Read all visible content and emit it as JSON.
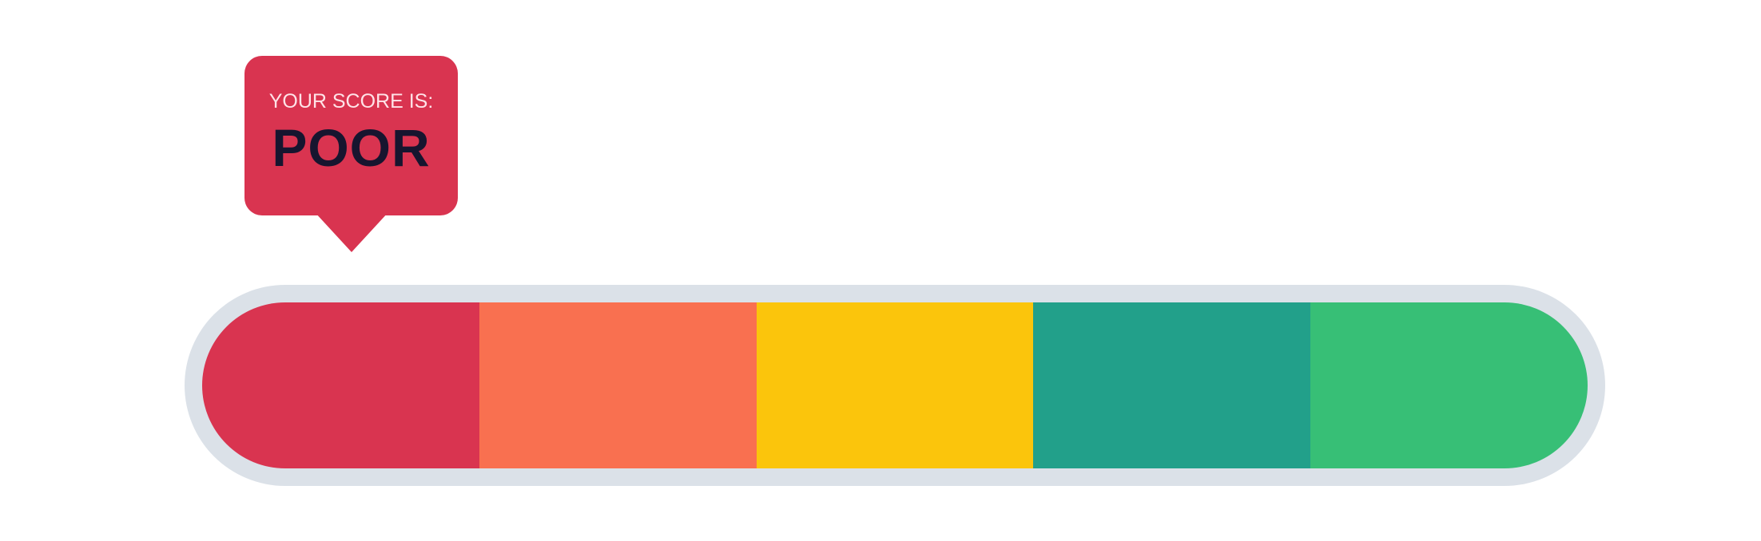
{
  "score_badge": {
    "caption": "YOUR SCORE IS:",
    "rating": "POOR",
    "color": "#d93450",
    "rating_color": "#17152f"
  },
  "gauge": {
    "track_color": "#dbe1e8",
    "selected_segment_index": 0,
    "segments": [
      {
        "color": "#d93450"
      },
      {
        "color": "#f97050"
      },
      {
        "color": "#fbc50c"
      },
      {
        "color": "#22a08a"
      },
      {
        "color": "#37bf76"
      }
    ]
  }
}
